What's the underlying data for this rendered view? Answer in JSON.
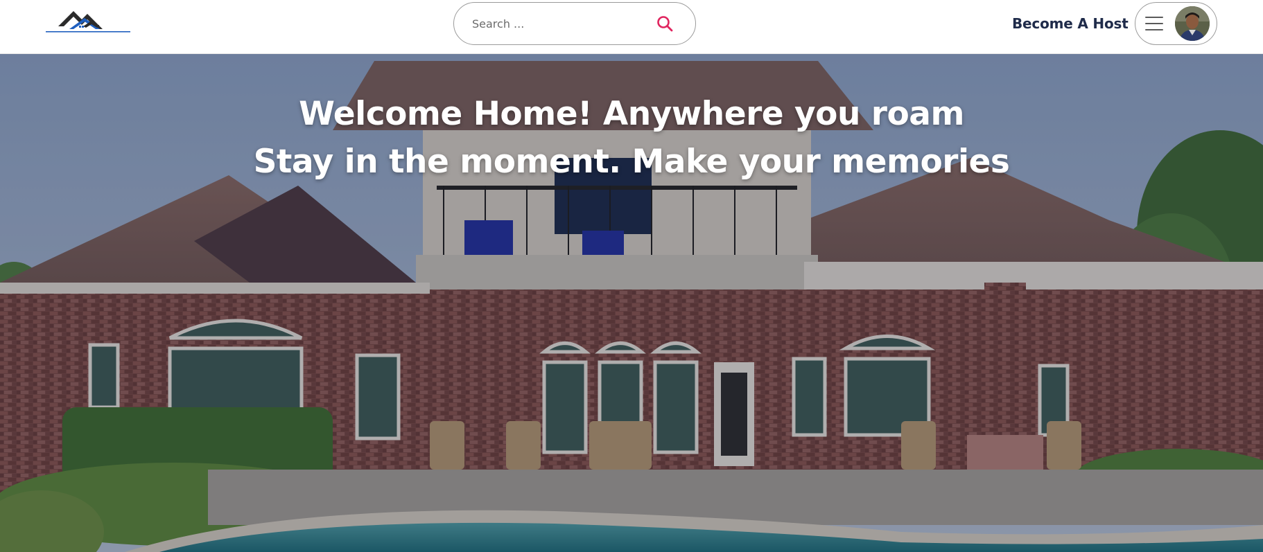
{
  "header": {
    "logo": {
      "icon": "house-mountain-logo",
      "colors": [
        "#2b2b2b",
        "#1f5fbf"
      ]
    },
    "search": {
      "placeholder": "Search ...",
      "value": "",
      "icon": "search-icon",
      "icon_color": "#e0245e"
    },
    "become_host_label": "Become A Host",
    "user_menu": {
      "menu_icon": "hamburger-icon",
      "avatar_icon": "user-avatar"
    }
  },
  "hero": {
    "line1": "Welcome Home! Anywhere you roam",
    "line2": "Stay in the moment. Make your memories",
    "background": "brick-house-with-pool-photo"
  },
  "colors": {
    "text_dark": "#1f2b4a",
    "accent": "#e0245e",
    "hero_text": "#ffffff"
  }
}
